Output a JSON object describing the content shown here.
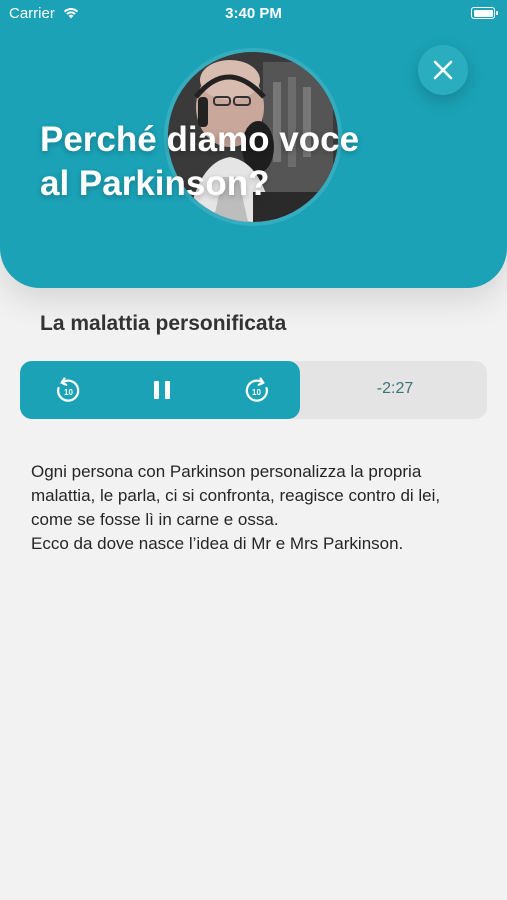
{
  "status_bar": {
    "carrier": "Carrier",
    "time": "3:40 PM"
  },
  "header": {
    "title": "Perché diamo voce al Parkinson?",
    "background_color": "#1ba2b6"
  },
  "section": {
    "title": "La malattia personificata"
  },
  "player": {
    "rewind_label": "10",
    "forward_label": "10",
    "remaining_time": "-2:27",
    "progress_fraction": 0.6,
    "accent_color": "#1ba2b6",
    "icons": [
      "rewind-10-icon",
      "pause-icon",
      "forward-10-icon"
    ]
  },
  "body": {
    "paragraph_1": "Ogni persona con Parkinson personalizza la propria malattia, le parla, ci si confronta, reagisce contro di lei, come se fosse lì in carne e ossa.",
    "paragraph_2": "Ecco da dove nasce l’idea di Mr e Mrs Parkinson."
  }
}
